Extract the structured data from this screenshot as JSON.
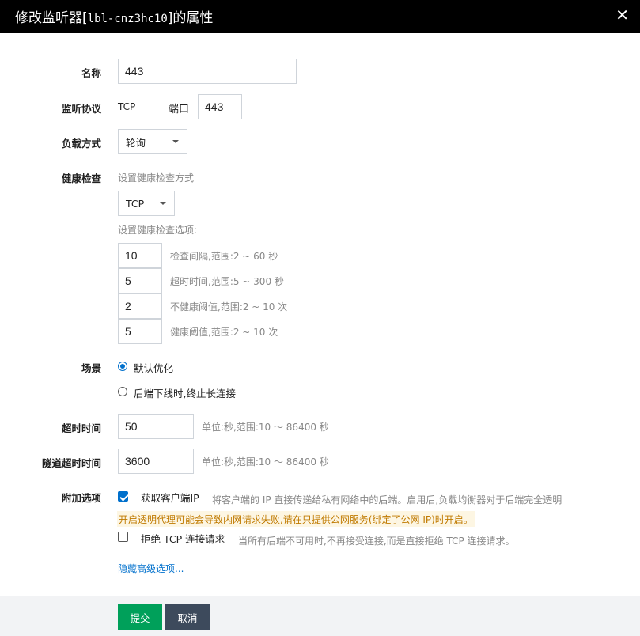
{
  "header": {
    "title_prefix": "修改监听器[",
    "title_id": "lbl-cnz3hc10",
    "title_suffix": "]的属性",
    "close_icon": "close-icon"
  },
  "form": {
    "name": {
      "label": "名称",
      "value": "443"
    },
    "protocol": {
      "label": "监听协议",
      "value": "TCP",
      "port_label": "端口",
      "port_value": "443"
    },
    "balance": {
      "label": "负载方式",
      "value": "轮询"
    },
    "health": {
      "label": "健康检查",
      "method_hint": "设置健康检查方式",
      "method_value": "TCP",
      "options_hint": "设置健康检查选项:",
      "options": [
        {
          "value": "10",
          "hint": "检查间隔,范围:2 ~ 60 秒"
        },
        {
          "value": "5",
          "hint": "超时时间,范围:5 ~ 300 秒"
        },
        {
          "value": "2",
          "hint": "不健康阈值,范围:2 ~ 10 次"
        },
        {
          "value": "5",
          "hint": "健康阈值,范围:2 ~ 10 次"
        }
      ]
    },
    "scene": {
      "label": "场景",
      "options": [
        {
          "label": "默认优化",
          "checked": true
        },
        {
          "label": "后端下线时,终止长连接",
          "checked": false
        }
      ]
    },
    "timeout": {
      "label": "超时时间",
      "value": "50",
      "hint": "单位:秒,范围:10 ～ 86400 秒"
    },
    "tunnel_timeout": {
      "label": "隧道超时时间",
      "value": "3600",
      "hint": "单位:秒,范围:10 ～ 86400 秒"
    },
    "extra": {
      "label": "附加选项",
      "client_ip": {
        "label": "获取客户端IP",
        "checked": true,
        "hint": "将客户端的 IP 直接传递给私有网络中的后端。启用后,负载均衡器对于后端完全透明"
      },
      "warning": "开启透明代理可能会导致内网请求失败,请在只提供公网服务(绑定了公网 IP)时开启。",
      "reject_tcp": {
        "label": "拒绝 TCP 连接请求",
        "checked": false,
        "hint": "当所有后端不可用时,不再接受连接,而是直接拒绝 TCP 连接请求。"
      }
    },
    "advanced_link": "隐藏高级选项..."
  },
  "footer": {
    "submit": "提交",
    "cancel": "取消"
  },
  "colors": {
    "header_bg": "#000000",
    "primary": "#00a05a",
    "secondary": "#3d4a5c",
    "accent": "#0070cc",
    "warning_text": "#c07a00"
  }
}
